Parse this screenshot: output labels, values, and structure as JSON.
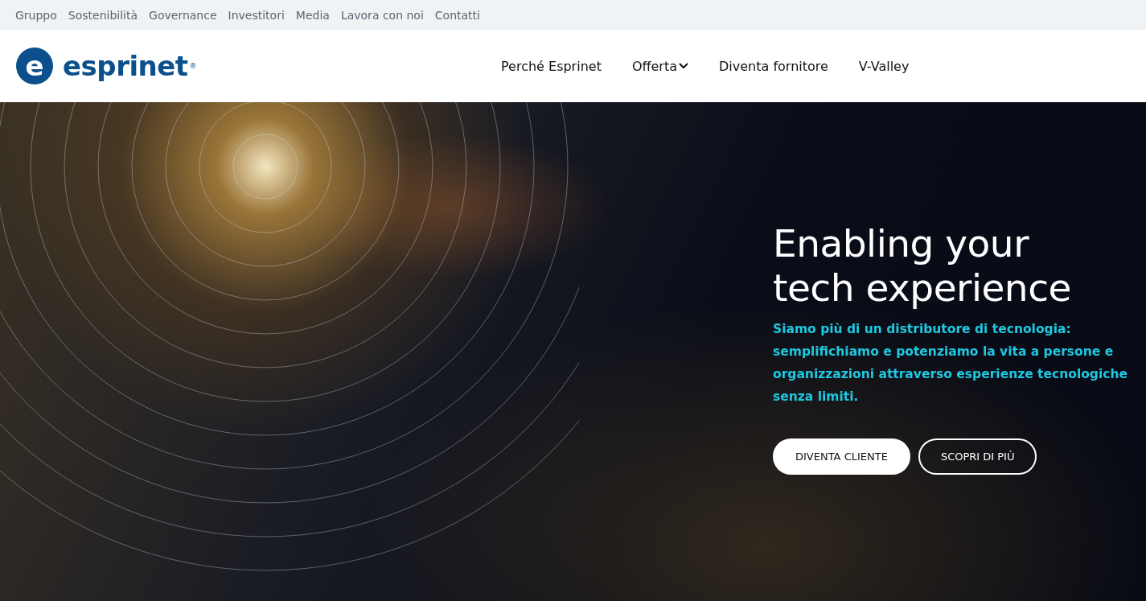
{
  "top_links": [
    "Gruppo",
    "Sostenibilità",
    "Governance",
    "Investitori",
    "Media",
    "Lavora con noi",
    "Contatti"
  ],
  "logo": {
    "mark": "e",
    "name": "esprinet",
    "registered": "®"
  },
  "nav": [
    {
      "label": "Perché Esprinet",
      "has_menu": false
    },
    {
      "label": "Offerta",
      "has_menu": true
    },
    {
      "label": "Diventa fornitore",
      "has_menu": false
    },
    {
      "label": "V-Valley",
      "has_menu": false
    }
  ],
  "hero": {
    "title": "Enabling your tech experience",
    "subtitle": "Siamo più di un distributore di tecnologia: semplifichiamo e potenziamo la vita a persone e organizzazioni attraverso esperienze tecnologiche senza limiti.",
    "buttons": [
      {
        "label": "DIVENTA CLIENTE",
        "kind": "filled"
      },
      {
        "label": "SCOPRI DI PIÙ",
        "kind": "outline"
      }
    ]
  }
}
